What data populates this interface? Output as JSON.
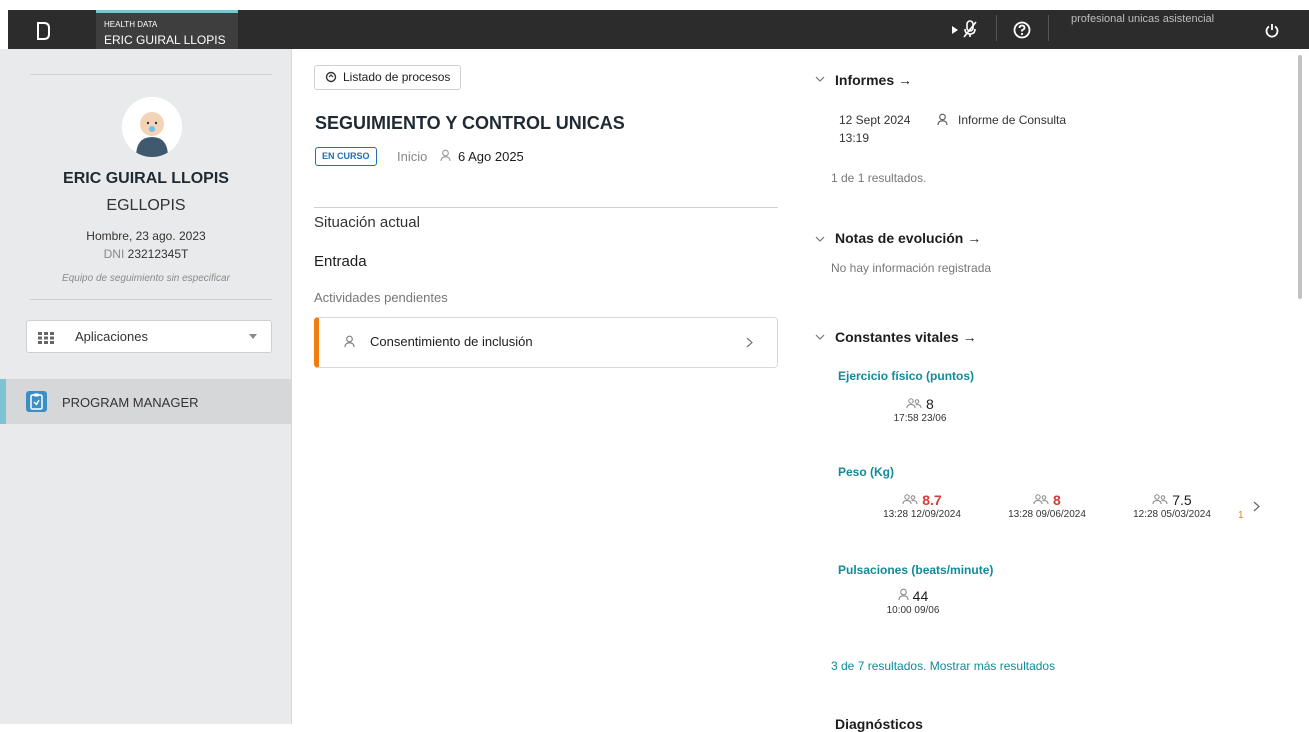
{
  "topbar": {
    "patient_tab_small": "HEALTH DATA",
    "patient_tab_name": "ERIC GUIRAL LLOPIS",
    "user_label": "profesional unicas asistencial"
  },
  "sidebar": {
    "name": "ERIC GUIRAL LLOPIS",
    "username": "EGLLOPIS",
    "info": "Hombre, 23 ago. 2023",
    "dni_label": "DNI",
    "dni_value": "23212345T",
    "team": "Equipo de seguimiento sin especificar",
    "apps_label": "Aplicaciones",
    "program_manager": "PROGRAM MANAGER"
  },
  "middle": {
    "chip_label": "Listado de procesos",
    "title": "SEGUIMIENTO Y CONTROL UNICAS",
    "badge": "EN CURSO",
    "inicio_label": "Inicio",
    "inicio_date": "6 Ago 2025",
    "situacion": "Situación actual",
    "entrada": "Entrada",
    "actividades_pendientes": "Actividades pendientes",
    "activity": "Consentimiento de inclusión"
  },
  "right": {
    "informes": {
      "title": "Informes →",
      "date": "12 Sept 2024",
      "time": "13:19",
      "report": "Informe de Consulta",
      "count": "1 de 1 resultados."
    },
    "notas": {
      "title": "Notas de evolución →",
      "empty": "No hay información registrada"
    },
    "constantes": {
      "title": "Constantes vitales →",
      "ejercicio": {
        "label": "Ejercicio físico (puntos)",
        "v1": "8",
        "t1": "17:58 23/06"
      },
      "peso": {
        "label": "Peso (Kg)",
        "v1": "8.7",
        "t1": "13:28 12/09/2024",
        "v2": "8",
        "t2": "13:28 09/06/2024",
        "v3": "7.5",
        "t3": "12:28 05/03/2024",
        "trailing": "1"
      },
      "pulsaciones": {
        "label": "Pulsaciones (beats/minute)",
        "v1": "44",
        "t1": "10:00 09/06"
      },
      "results_link": "3 de 7 resultados. Mostrar más resultados"
    },
    "next_section_partial": "Diagnósticos"
  },
  "colors": {
    "accent_teal": "#118a99",
    "badge_blue": "#1f6fb2",
    "activity_orange": "#ef7d0f",
    "value_red": "#d63b3b"
  }
}
